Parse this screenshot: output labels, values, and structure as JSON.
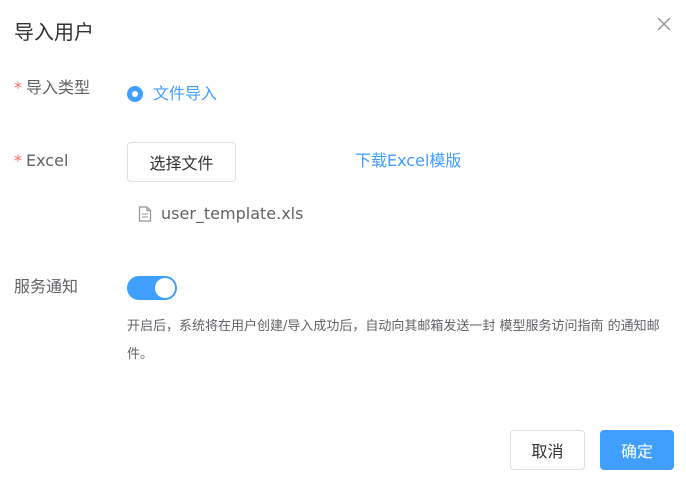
{
  "dialog": {
    "title": "导入用户",
    "close_icon": "close-icon"
  },
  "import_type": {
    "required_mark": "*",
    "label": "导入类型",
    "option_label": "文件导入",
    "selected": true
  },
  "excel": {
    "required_mark": "*",
    "label": "Excel",
    "upload_button": "选择文件",
    "download_link": "下载Excel模版",
    "file_icon": "document-icon",
    "file_name": "user_template.xls"
  },
  "notification": {
    "label": "服务通知",
    "enabled": true,
    "description": "开启后，系统将在用户创建/导入成功后，自动向其邮箱发送一封 模型服务访问指南 的通知邮件。"
  },
  "footer": {
    "cancel_label": "取消",
    "confirm_label": "确定"
  },
  "colors": {
    "primary": "#409eff",
    "required": "#f56c6c",
    "text": "#606266",
    "title": "#303133",
    "border": "#dcdfe6"
  }
}
